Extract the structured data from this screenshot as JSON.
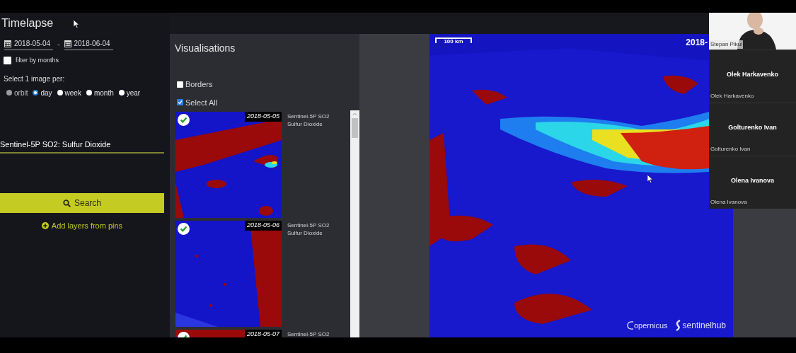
{
  "timelapse": {
    "title": "Timelapse",
    "date_from": "2018-05-04",
    "separator": "-",
    "date_to": "2018-06-04",
    "filter_by_months": {
      "label": "filter by months",
      "checked": false
    },
    "select_label": "Select 1 image per:",
    "periods": [
      {
        "label": "orbit",
        "selected": false,
        "disabled": true
      },
      {
        "label": "day",
        "selected": true,
        "disabled": false
      },
      {
        "label": "week",
        "selected": false,
        "disabled": false
      },
      {
        "label": "month",
        "selected": false,
        "disabled": false
      },
      {
        "label": "year",
        "selected": false,
        "disabled": false
      }
    ],
    "layer_field": {
      "value": "Sentinel-5P SO2: Sulfur Dioxide"
    },
    "search_button": "Search",
    "add_layers_link": "Add layers from pins"
  },
  "visualisations": {
    "title": "Visualisations",
    "options": [
      {
        "label": "Borders",
        "checked": false
      },
      {
        "label": "Select All",
        "checked": true
      }
    ],
    "frames": [
      {
        "date": "2018-05-05",
        "lines": [
          "Sentinel-5P SO2",
          "Sulfur Dioxide"
        ],
        "checked": true
      },
      {
        "date": "2018-05-06",
        "lines": [
          "Sentinel-5P SO2",
          "Sulfur Dioxide"
        ],
        "checked": true
      },
      {
        "date": "2018-05-07",
        "lines": [
          "Sentinel-5P SO2"
        ],
        "checked": true
      }
    ]
  },
  "map": {
    "scale": "100 km",
    "date": "2018-",
    "logos": [
      "opernicus",
      "sentinelhub"
    ]
  },
  "participants": [
    {
      "kind": "video",
      "label": "Stepan Pikul"
    },
    {
      "kind": "name",
      "title": "Olek Harkavenko",
      "label": "Olek Harkavenko"
    },
    {
      "kind": "name",
      "title": "Golturenko Ivan",
      "label": "Golturenko Ivan"
    },
    {
      "kind": "name",
      "title": "Olena Ivanova",
      "label": "Olena Ivanova"
    }
  ]
}
